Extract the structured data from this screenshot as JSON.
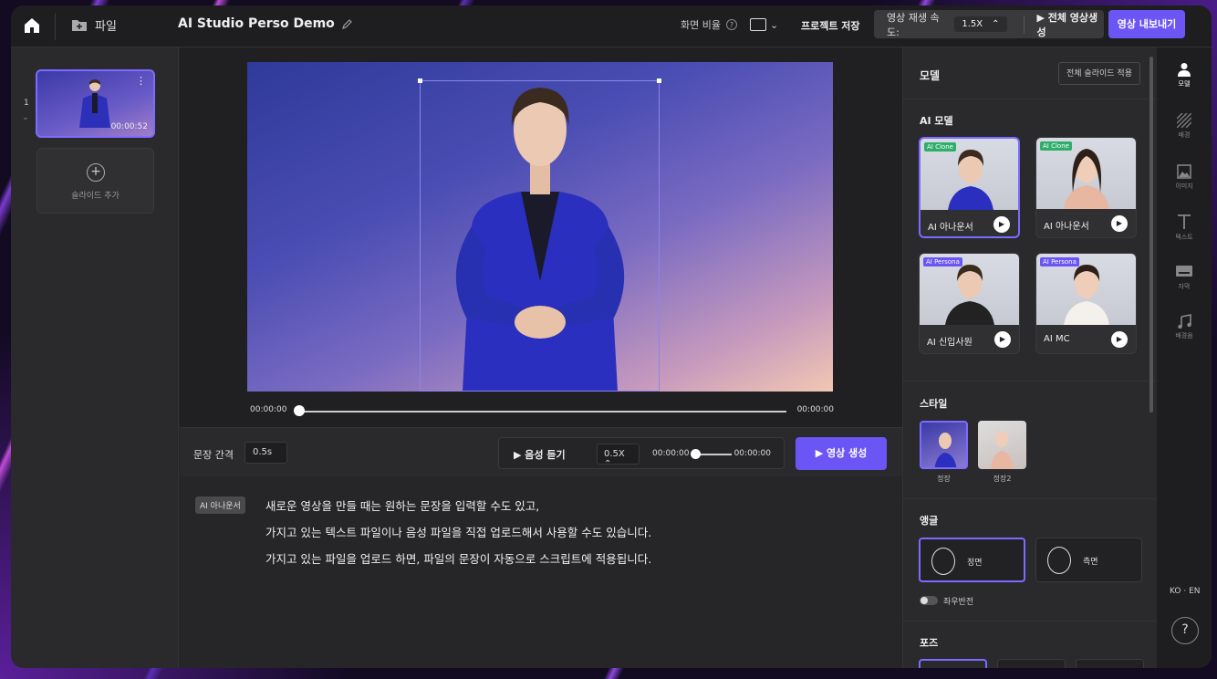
{
  "header": {
    "file_label": "파일",
    "project_title": "AI Studio Perso Demo",
    "ratio_label": "화면 비율",
    "ratio_help": "?",
    "save_label": "프로젝트 저장",
    "speed_label": "영상 재생 속도:",
    "speed_value": "1.5X",
    "generate_all_label": "▶ 전체 영상생성",
    "export_label": "영상 내보내기"
  },
  "slides": {
    "items": [
      {
        "number": "1",
        "duration": "00:00:52"
      }
    ],
    "add_label": "슬라이드 추가"
  },
  "player": {
    "current_time": "00:00:00",
    "total_time": "00:00:00",
    "progress": 0
  },
  "script": {
    "gap_label": "문장 간격",
    "gap_value": "0.5s",
    "listen_label": "▶ 음성 듣기",
    "rate_value": "0.5X ⌃",
    "audio_current": "00:00:00",
    "audio_total": "00:00:00",
    "generate_label": "▶ 영상 생성",
    "speaker_tag": "AI 아나운서",
    "lines": [
      "새로운 영상을 만들 때는 원하는 문장을 입력할 수도 있고,",
      "가지고 있는 텍스트 파일이나 음성 파일을 직접 업로드해서 사용할 수도 있습니다.",
      "가지고 있는 파일을 업로드 하면, 파일의 문장이 자동으로 스크립트에 적용됩니다."
    ]
  },
  "right_panel": {
    "title": "모델",
    "apply_all_label": "전체 슬라이드 적용",
    "ai_model_section": "AI 모델",
    "models": [
      {
        "badge": "AI Clone",
        "name": "AI 아나운서",
        "badge_color": "#2fae6a",
        "selected": true
      },
      {
        "badge": "AI Clone",
        "name": "AI 아나운서",
        "badge_color": "#2fae6a",
        "selected": false
      },
      {
        "badge": "AI Persona",
        "name": "AI 신입사원",
        "badge_color": "#6b55f5",
        "selected": false
      },
      {
        "badge": "AI Persona",
        "name": "AI MC",
        "badge_color": "#6b55f5",
        "selected": false
      }
    ],
    "style_section": "스타일",
    "styles": [
      "정장",
      "정장2"
    ],
    "angle_section": "앵글",
    "angles": [
      "정면",
      "측면"
    ],
    "flip_label": "좌우반전",
    "pose_section": "포즈"
  },
  "sidebar_icons": [
    {
      "icon": "person-icon",
      "label": "모델"
    },
    {
      "icon": "background-icon",
      "label": "배경"
    },
    {
      "icon": "image-icon",
      "label": "이미지"
    },
    {
      "icon": "text-icon",
      "label": "텍스트"
    },
    {
      "icon": "subtitle-icon",
      "label": "자막"
    },
    {
      "icon": "music-icon",
      "label": "배경음"
    }
  ],
  "language": "KO · EN",
  "help": "?",
  "colors": {
    "accent": "#6b55f5",
    "panel": "#2a2a2c"
  }
}
